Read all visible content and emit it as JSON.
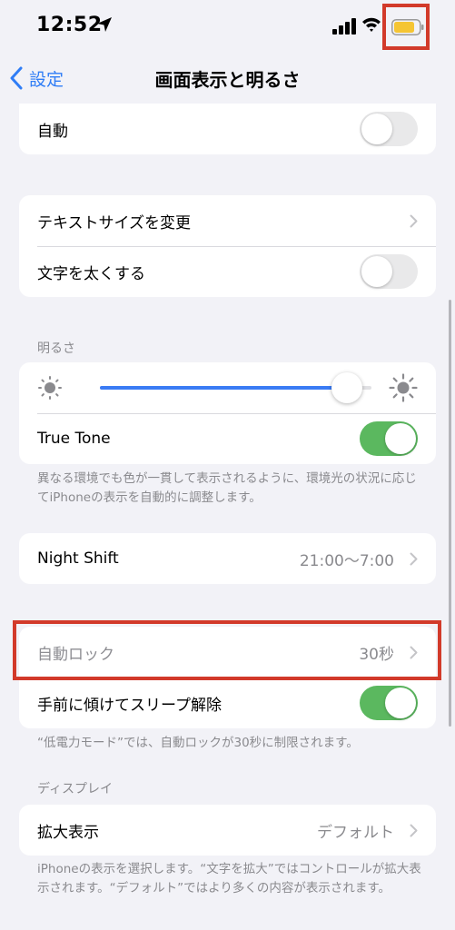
{
  "status": {
    "time": "12:52",
    "battery_color": "#f5c534",
    "highlight_color": "#d23a2a"
  },
  "nav": {
    "back_label": "設定",
    "title": "画面表示と明るさ"
  },
  "auto_group": {
    "auto_label": "自動",
    "auto_on": false
  },
  "text_group": {
    "text_size_label": "テキストサイズを変更",
    "bold_text_label": "文字を太くする",
    "bold_text_on": false
  },
  "brightness": {
    "header": "明るさ",
    "level": 0.91,
    "true_tone_label": "True Tone",
    "true_tone_on": true,
    "footer": "異なる環境でも色が一貫して表示されるように、環境光の状況に応じてiPhoneの表示を自動的に調整します。"
  },
  "night_shift": {
    "label": "Night Shift",
    "value": "21:00〜7:00"
  },
  "lock_group": {
    "auto_lock_label": "自動ロック",
    "auto_lock_value": "30秒",
    "raise_to_wake_label": "手前に傾けてスリープ解除",
    "raise_to_wake_on": true,
    "footer": "“低電力モード”では、自動ロックが30秒に制限されます。"
  },
  "display": {
    "header": "ディスプレイ",
    "zoom_label": "拡大表示",
    "zoom_value": "デフォルト",
    "footer": "iPhoneの表示を選択します。“文字を拡大”ではコントロールが拡大表示されます。“デフォルト”ではより多くの内容が表示されます。"
  },
  "colors": {
    "accent_blue": "#2f7df6",
    "toggle_on_green": "#5bb85f",
    "toggle_off_gray": "#e9e9ea",
    "background": "#f2f2f7"
  }
}
